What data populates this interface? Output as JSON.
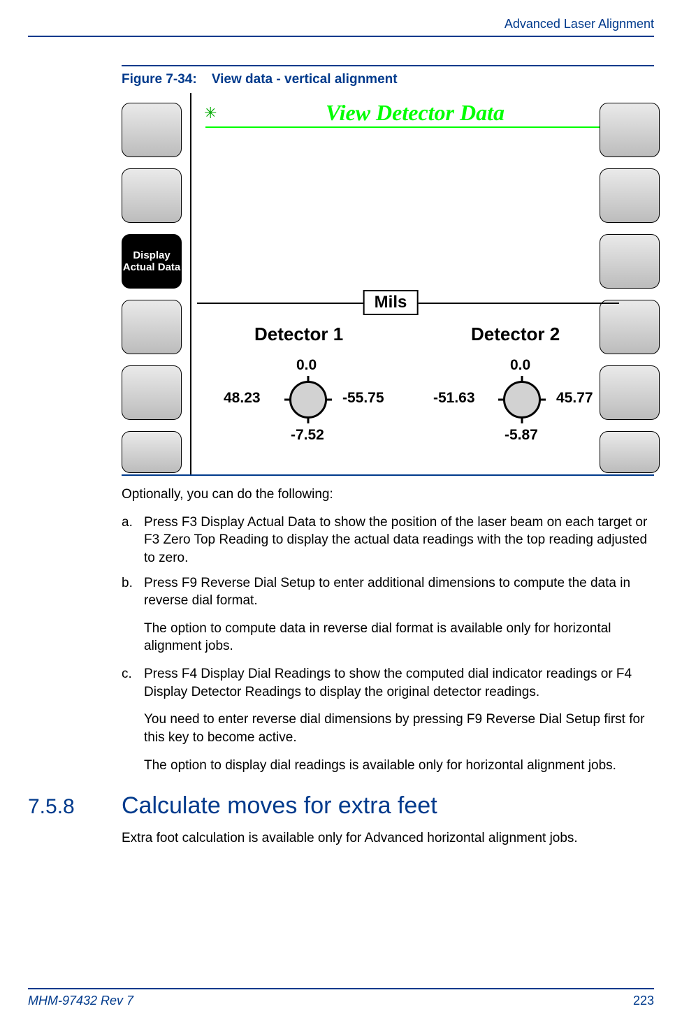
{
  "header": {
    "chapter": "Advanced Laser Alignment"
  },
  "figure": {
    "label": "Figure 7-34:",
    "caption": "View data - vertical alignment",
    "screen": {
      "title": "View Detector Data",
      "units": "Mils",
      "left_softkey_active": "Display Actual Data",
      "detectors": [
        {
          "name": "Detector 1",
          "top": "0.0",
          "left": "48.23",
          "right": "-55.75",
          "bottom": "-7.52"
        },
        {
          "name": "Detector 2",
          "top": "0.0",
          "left": "-51.63",
          "right": "45.77",
          "bottom": "-5.87"
        }
      ]
    }
  },
  "body": {
    "intro": "Optionally, you can do the following:",
    "items": [
      {
        "marker": "a.",
        "text_pre": "Press ",
        "ui1": "F3 Display Actual Data",
        "text_mid1": " to show the position of the laser beam on each target or ",
        "ui2": "F3 Zero Top Reading",
        "text_post": " to display the actual data readings with the top reading adjusted to zero."
      },
      {
        "marker": "b.",
        "text_pre": "Press ",
        "ui1": "F9 Reverse Dial Setup",
        "text_mid1": " to enter additional dimensions to compute the data in reverse dial format.",
        "ui2": "",
        "text_post": "",
        "note": "The option to compute data in reverse dial format is available only for horizontal alignment jobs."
      },
      {
        "marker": "c.",
        "text_pre": "Press ",
        "ui1": "F4 Display Dial Readings",
        "text_mid1": " to show the computed dial indicator readings or ",
        "ui2": "F4 Display Detector Readings",
        "text_post": " to display the original detector readings.",
        "note": "You need to enter reverse dial dimensions by pressing F9 Reverse Dial Setup first for this key to become active.",
        "note_ui": "F9 Reverse Dial Setup",
        "note_pre": "You need to enter reverse dial dimensions by pressing ",
        "note_post": " first for this key to become active.",
        "note2": "The option to display dial readings is available only for horizontal alignment jobs."
      }
    ]
  },
  "section": {
    "number": "7.5.8",
    "title": "Calculate moves for extra feet",
    "text": "Extra foot calculation is available only for Advanced horizontal alignment jobs."
  },
  "footer": {
    "docid": "MHM-97432 Rev 7",
    "page": "223"
  }
}
